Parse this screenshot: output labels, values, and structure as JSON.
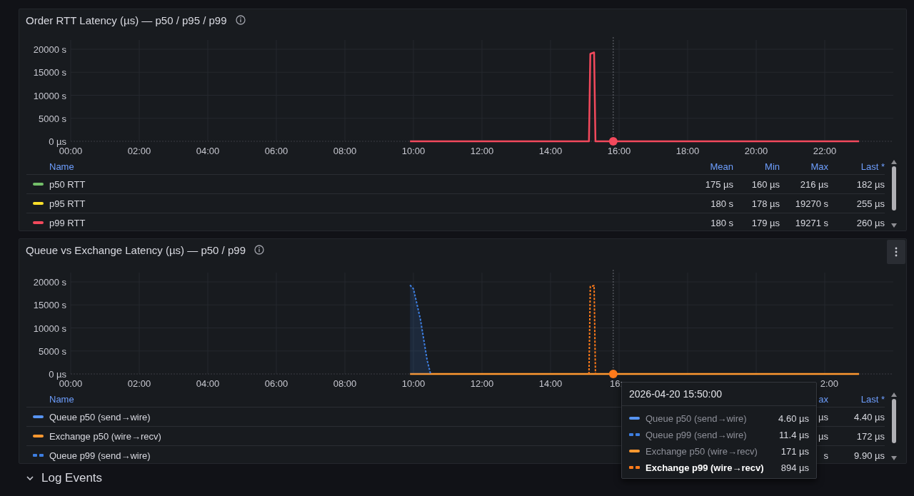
{
  "panels": [
    {
      "title": "Order RTT Latency (µs) — p50 / p95 / p99",
      "chart_data": {
        "type": "line",
        "xlim": [
          0,
          24
        ],
        "ylim": [
          0,
          22000
        ],
        "grid": true,
        "xticks": [
          {
            "value": 0,
            "label": "00:00"
          },
          {
            "value": 2,
            "label": "02:00"
          },
          {
            "value": 4,
            "label": "04:00"
          },
          {
            "value": 6,
            "label": "06:00"
          },
          {
            "value": 8,
            "label": "08:00"
          },
          {
            "value": 10,
            "label": "10:00"
          },
          {
            "value": 12,
            "label": "12:00"
          },
          {
            "value": 14,
            "label": "14:00"
          },
          {
            "value": 16,
            "label": "16:00"
          },
          {
            "value": 18,
            "label": "18:00"
          },
          {
            "value": 20,
            "label": "20:00"
          },
          {
            "value": 22,
            "label": "22:00"
          }
        ],
        "yticks": [
          {
            "value": 0,
            "label": "0 µs"
          },
          {
            "value": 5000,
            "label": "5000 s"
          },
          {
            "value": 10000,
            "label": "10000 s"
          },
          {
            "value": 15000,
            "label": "15000 s"
          },
          {
            "value": 20000,
            "label": "20000 s"
          }
        ],
        "x": [
          9.9,
          15.12,
          15.16,
          15.27,
          15.31,
          23.0
        ],
        "series": [
          {
            "color": "#f2495c",
            "line_style": "solid",
            "values": [
              0,
              0,
              19000,
              19300,
              0,
              0
            ]
          }
        ],
        "ref_lines": [
          {
            "axis": "x",
            "value": 15.83
          }
        ]
      },
      "legend": {
        "columns": [
          "Name",
          "Mean",
          "Min",
          "Max",
          "Last *"
        ],
        "rows": [
          {
            "color": "#73bf69",
            "kind": "solid",
            "cells": [
              "p50 RTT",
              "175 µs",
              "160 µs",
              "216 µs",
              "182 µs"
            ]
          },
          {
            "color": "#fade2a",
            "kind": "solid",
            "cells": [
              "p95 RTT",
              "180 s",
              "178 µs",
              "19270 s",
              "255 µs"
            ]
          },
          {
            "color": "#f2495c",
            "kind": "solid",
            "cells": [
              "p99 RTT",
              "180 s",
              "179 µs",
              "19271 s",
              "260 µs"
            ]
          }
        ]
      }
    },
    {
      "title": "Queue vs Exchange Latency (µs) — p50 / p99",
      "menu_button": true,
      "chart_data": {
        "type": "line",
        "xlim": [
          0,
          24
        ],
        "ylim": [
          0,
          22000
        ],
        "grid": true,
        "xticks": [
          {
            "value": 0,
            "label": "00:00"
          },
          {
            "value": 2,
            "label": "02:00"
          },
          {
            "value": 4,
            "label": "04:00"
          },
          {
            "value": 6,
            "label": "06:00"
          },
          {
            "value": 8,
            "label": "08:00"
          },
          {
            "value": 10,
            "label": "10:00"
          },
          {
            "value": 12,
            "label": "12:00"
          },
          {
            "value": 14,
            "label": "14:00"
          }
        ],
        "yticks": [
          {
            "value": 0,
            "label": "0 µs"
          },
          {
            "value": 5000,
            "label": "5000 s"
          },
          {
            "value": 10000,
            "label": "10000 s"
          },
          {
            "value": 15000,
            "label": "15000 s"
          },
          {
            "value": 20000,
            "label": "20000 s"
          }
        ],
        "x": [
          9.9,
          10.0,
          10.2,
          10.4,
          10.5,
          15.12,
          15.16,
          15.27,
          15.31,
          23.0
        ],
        "series": [
          {
            "color": "#ff9830",
            "line_style": "solid",
            "values": [
              0,
              0,
              0,
              0,
              0,
              0,
              0,
              0,
              0,
              0
            ]
          },
          {
            "color": "#3d7ee0",
            "line_style": "dashed",
            "values": [
              19300,
              18500,
              12000,
              3000,
              0,
              null,
              null,
              null,
              null,
              null
            ]
          },
          {
            "color": "#ff7a1a",
            "line_style": "dashed",
            "values": [
              null,
              null,
              null,
              null,
              null,
              0,
              19000,
              19200,
              0,
              null
            ]
          }
        ],
        "ref_lines": [
          {
            "axis": "x",
            "value": 15.83
          }
        ]
      },
      "x_axis_fragments": [
        "16:",
        "2:00"
      ],
      "legend": {
        "columns": [
          "Name",
          "ax",
          "Last *"
        ],
        "rows": [
          {
            "color": "#5794f2",
            "kind": "solid",
            "cells": [
              "Queue p50 (send→wire)",
              "µs",
              "4.40 µs"
            ]
          },
          {
            "color": "#ff9830",
            "kind": "solid",
            "cells": [
              "Exchange p50 (wire→recv)",
              "µs",
              "172 µs"
            ]
          },
          {
            "color": "#3d7ee0",
            "kind": "dashed",
            "cells": [
              "Queue p99 (send→wire)",
              "s",
              "9.90 µs"
            ]
          }
        ]
      },
      "tooltip": {
        "title": "2026-04-20 15:50:00",
        "rows": [
          {
            "label": "Queue p50 (send→wire)",
            "value": "4.60 µs",
            "color": "#5794f2",
            "kind": "solid",
            "selected": false
          },
          {
            "label": "Queue p99 (send→wire)",
            "value": "11.4 µs",
            "color": "#3d7ee0",
            "kind": "dashed",
            "selected": false
          },
          {
            "label": "Exchange p50 (wire→recv)",
            "value": "171 µs",
            "color": "#ff9830",
            "kind": "solid",
            "selected": false
          },
          {
            "label": "Exchange p99 (wire→recv)",
            "value": "894 µs",
            "color": "#ff7a1a",
            "kind": "dashed",
            "selected": true
          }
        ]
      }
    }
  ],
  "row_header": {
    "title": "Log Events",
    "expanded": true
  }
}
